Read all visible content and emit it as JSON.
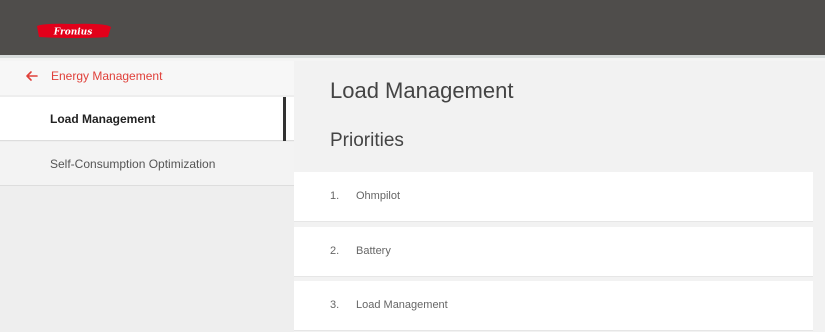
{
  "header": {
    "brand": "Fronius",
    "brand_color": "#e2001a"
  },
  "sidebar": {
    "back_label": "Energy Management",
    "items": [
      {
        "label": "Load Management",
        "active": true
      },
      {
        "label": "Self-Consumption Optimization",
        "active": false
      }
    ]
  },
  "main": {
    "title": "Load Management",
    "section_title": "Priorities",
    "priorities": [
      {
        "number": "1.",
        "name": "Ohmpilot"
      },
      {
        "number": "2.",
        "name": "Battery"
      },
      {
        "number": "3.",
        "name": "Load Management"
      }
    ]
  },
  "colors": {
    "accent": "#e0403a",
    "header_bg": "#4f4d4b"
  },
  "icons": {
    "back": "arrow-left-icon",
    "logo": "fronius-logo"
  }
}
